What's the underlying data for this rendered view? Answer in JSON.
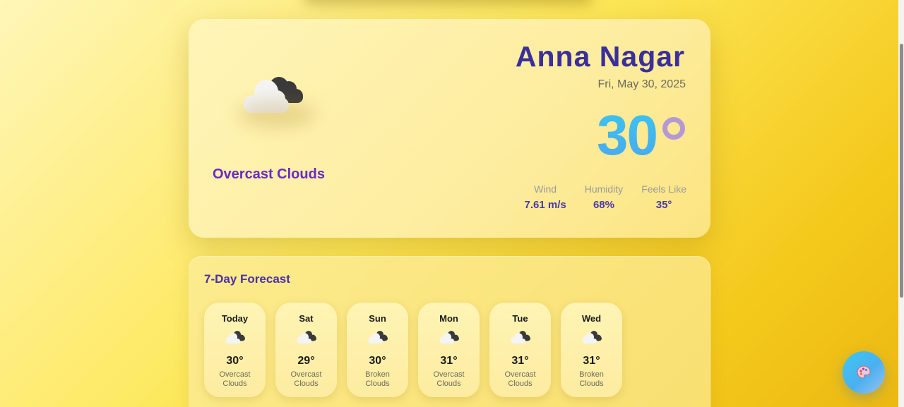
{
  "location": {
    "city": "Anna Nagar",
    "date": "Fri, May 30, 2025"
  },
  "current": {
    "condition": "Overcast Clouds",
    "temperature": "30",
    "icon": "overcast-clouds-icon",
    "stats": [
      {
        "label": "Wind",
        "value": "7.61 m/s"
      },
      {
        "label": "Humidity",
        "value": "68%"
      },
      {
        "label": "Feels Like",
        "value": "35°"
      }
    ]
  },
  "forecast": {
    "title": "7-Day Forecast",
    "days": [
      {
        "day": "Today",
        "temp": "30°",
        "desc": "Overcast Clouds",
        "icon": "overcast-clouds-icon"
      },
      {
        "day": "Sat",
        "temp": "29°",
        "desc": "Overcast Clouds",
        "icon": "overcast-clouds-icon"
      },
      {
        "day": "Sun",
        "temp": "30°",
        "desc": "Broken Clouds",
        "icon": "broken-clouds-icon"
      },
      {
        "day": "Mon",
        "temp": "31°",
        "desc": "Overcast Clouds",
        "icon": "overcast-clouds-icon"
      },
      {
        "day": "Tue",
        "temp": "31°",
        "desc": "Overcast Clouds",
        "icon": "overcast-clouds-icon"
      },
      {
        "day": "Wed",
        "temp": "31°",
        "desc": "Broken Clouds",
        "icon": "broken-clouds-icon"
      }
    ]
  },
  "theme_button": {
    "icon": "palette-icon"
  },
  "colors": {
    "accent_purple": "#6a2ac8",
    "city_navy": "#3a2f9c",
    "temp_cyan": "#3cc4f0"
  }
}
